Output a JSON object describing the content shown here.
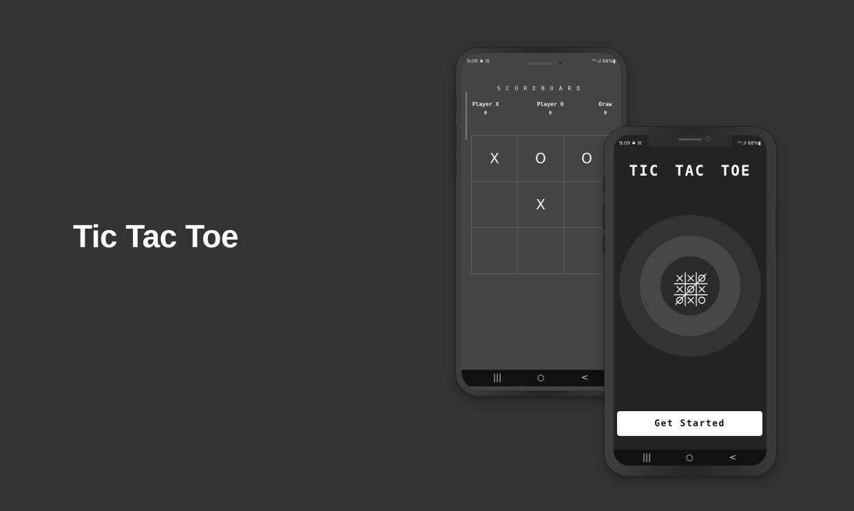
{
  "page": {
    "title": "Tic Tac Toe"
  },
  "game_screen": {
    "status": {
      "time": "9:09 ♣ ☒",
      "system": "⁵ᴳ.ıl 68%▮"
    },
    "scoreboard": {
      "title": "SCOREBOARD",
      "columns": [
        {
          "label": "Player X",
          "value": "0"
        },
        {
          "label": "Player O",
          "value": "0"
        },
        {
          "label": "Draw",
          "value": "0"
        }
      ]
    },
    "board": [
      "X",
      "O",
      "O",
      "",
      "X",
      "",
      "",
      "",
      ""
    ],
    "nav": {
      "recent": "|||",
      "home": "○",
      "back": "<"
    }
  },
  "welcome_screen": {
    "status": {
      "time": "9:09 ♣ ☒",
      "system": "⁵ᴳ.ıl 68%▮"
    },
    "title": "TIC TAC TOE",
    "logo_icon": "tic-tac-toe-grid-icon",
    "get_started_label": "Get Started",
    "nav": {
      "recent": "|||",
      "home": "○",
      "back": "<"
    }
  },
  "colors": {
    "background": "#333333",
    "game_screen_bg": "#444444",
    "welcome_screen_bg": "#232323",
    "ring_outer": "#333333",
    "ring_middle": "#474747",
    "ring_inner": "#2a2a2a",
    "button_bg": "#ffffff"
  }
}
